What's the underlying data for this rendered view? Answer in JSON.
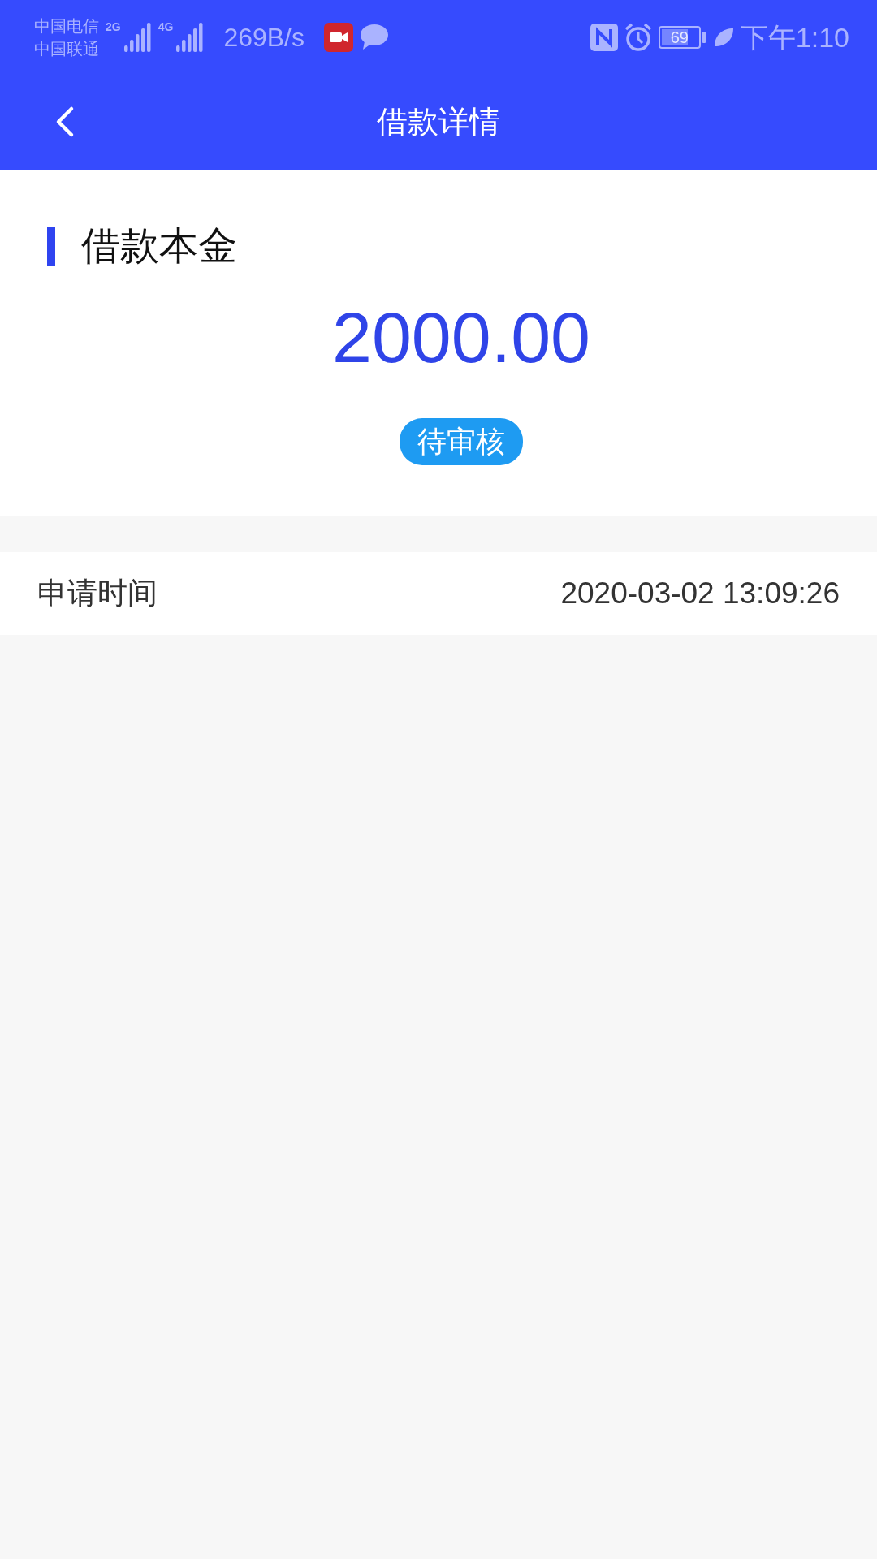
{
  "status_bar": {
    "carriers": [
      "中国电信",
      "中国联通"
    ],
    "network_labels": [
      "2G",
      "4G"
    ],
    "speed": "269B/s",
    "battery": "69",
    "time": "下午1:10"
  },
  "header": {
    "title": "借款详情"
  },
  "summary": {
    "heading": "借款本金",
    "amount": "2000.00",
    "status": "待审核"
  },
  "details": [
    {
      "label": "申请时间",
      "value": "2020-03-02 13:09:26"
    }
  ]
}
